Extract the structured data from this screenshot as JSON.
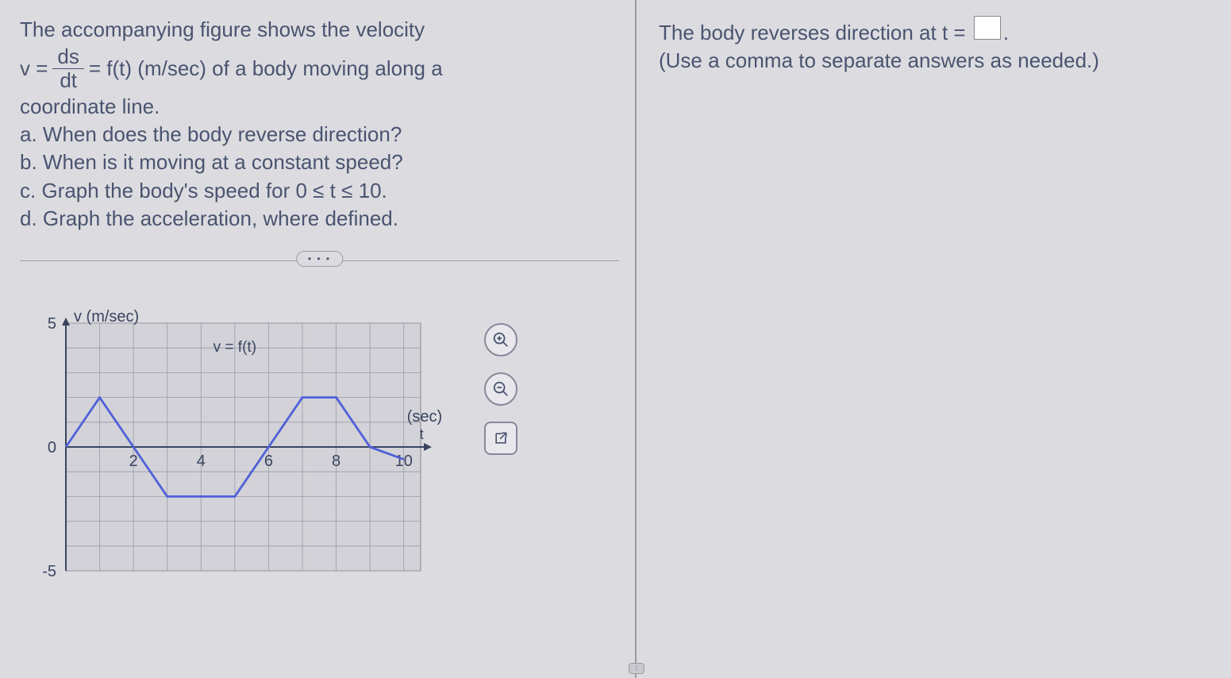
{
  "problem": {
    "line1": "The accompanying figure shows the velocity",
    "vEq_lhs": "v =",
    "vEq_num": "ds",
    "vEq_den": "dt",
    "vEq_rhs": "= f(t) (m/sec) of a body moving along a",
    "line3": "coordinate line.",
    "qa": "a. When does the body reverse direction?",
    "qb": "b. When is it moving at a constant speed?",
    "qc": "c. Graph the body's speed for 0 ≤ t ≤ 10.",
    "qd": "d. Graph the acceleration, where defined."
  },
  "dots": "• • •",
  "chart_data": {
    "type": "line",
    "title": "",
    "ylabel": "v (m/sec)",
    "xlabel": "(sec)",
    "xlabel2": "t",
    "series_label": "v = f(t)",
    "xlim": [
      0,
      10.5
    ],
    "ylim": [
      -5,
      5
    ],
    "x_ticks": [
      0,
      2,
      4,
      6,
      8,
      10
    ],
    "y_ticks": [
      -5,
      0,
      5
    ],
    "x_tick_labels": [
      "",
      "2",
      "4",
      "6",
      "8",
      "10"
    ],
    "y_tick_labels": [
      "-5",
      "0",
      "5"
    ],
    "x": [
      0,
      1,
      2,
      3,
      5,
      6,
      7,
      8,
      9,
      10
    ],
    "y": [
      0,
      2,
      0,
      -2,
      -2,
      0,
      2,
      2,
      0,
      -0.5
    ]
  },
  "answer": {
    "prefix": "The body reverses direction at t =",
    "suffix": ".",
    "hint": "(Use a comma to separate answers as needed.)"
  }
}
